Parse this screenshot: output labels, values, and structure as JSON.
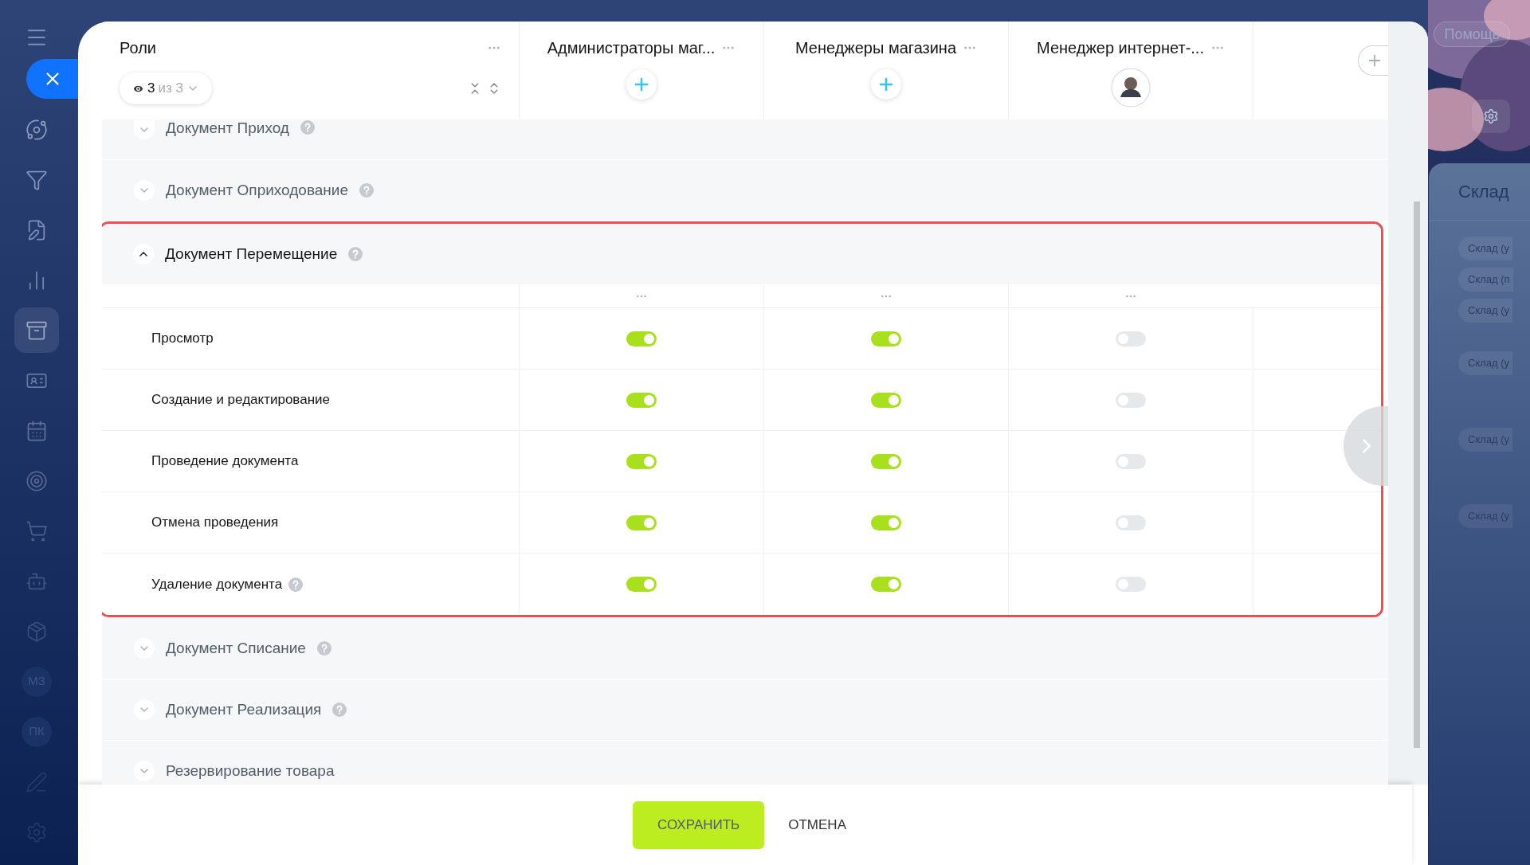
{
  "sidebar": {
    "items": [
      {
        "kind": "icon",
        "selected": false
      },
      {
        "kind": "icon",
        "selected": false
      },
      {
        "kind": "icon",
        "selected": false
      },
      {
        "kind": "icon",
        "selected": false
      },
      {
        "kind": "icon",
        "selected": true
      },
      {
        "kind": "icon",
        "selected": false
      },
      {
        "kind": "icon",
        "selected": false
      },
      {
        "kind": "icon",
        "selected": false
      },
      {
        "kind": "icon",
        "selected": false
      },
      {
        "kind": "icon",
        "selected": false
      },
      {
        "kind": "icon",
        "selected": false
      },
      {
        "kind": "text",
        "label": "МЗ",
        "selected": false
      },
      {
        "kind": "text",
        "label": "ПК",
        "selected": false
      },
      {
        "kind": "icon",
        "selected": false
      },
      {
        "kind": "icon",
        "selected": false
      }
    ]
  },
  "roles": {
    "title": "Роли",
    "filter": {
      "count": "3",
      "total": "из 3"
    },
    "columns": [
      {
        "title": "Администраторы маг...",
        "kind": "add"
      },
      {
        "title": "Менеджеры магазина",
        "kind": "add"
      },
      {
        "title": "Менеджер интернет-...",
        "kind": "avatar"
      }
    ]
  },
  "sections": [
    {
      "title": "Документ Приход",
      "help": true,
      "expanded": false,
      "highlighted": false
    },
    {
      "title": "Документ Оприходование",
      "help": true,
      "expanded": false,
      "highlighted": false
    },
    {
      "title": "Документ Перемещение",
      "help": true,
      "expanded": true,
      "highlighted": true,
      "permissions": [
        {
          "label": "Просмотр",
          "help": false,
          "toggles": [
            {
              "on": true
            },
            {
              "on": true
            },
            {
              "on": false
            }
          ]
        },
        {
          "label": "Создание и редактирование",
          "help": false,
          "toggles": [
            {
              "on": true
            },
            {
              "on": true
            },
            {
              "on": false
            }
          ]
        },
        {
          "label": "Проведение документа",
          "help": false,
          "toggles": [
            {
              "on": true
            },
            {
              "on": true
            },
            {
              "on": false
            }
          ]
        },
        {
          "label": "Отмена проведения",
          "help": false,
          "toggles": [
            {
              "on": true
            },
            {
              "on": true
            },
            {
              "on": false
            }
          ]
        },
        {
          "label": "Удаление документа",
          "help": true,
          "toggles": [
            {
              "on": true
            },
            {
              "on": true
            },
            {
              "on": false
            }
          ]
        }
      ]
    },
    {
      "title": "Документ Списание",
      "help": true,
      "expanded": false,
      "highlighted": false
    },
    {
      "title": "Документ Реализация",
      "help": true,
      "expanded": false,
      "highlighted": false
    },
    {
      "title": "Резервирование товара",
      "help": false,
      "expanded": false,
      "highlighted": false
    }
  ],
  "footer": {
    "buttons": [
      "СОХРАНИТЬ",
      "ОТМЕНА"
    ]
  },
  "background": {
    "help_button": "Помощь",
    "panel_title": "Склад",
    "chips": [
      "Склад (у",
      "Склад (п",
      "Склад (у",
      "Склад (у",
      "Склад (у",
      "Склад (у"
    ]
  }
}
